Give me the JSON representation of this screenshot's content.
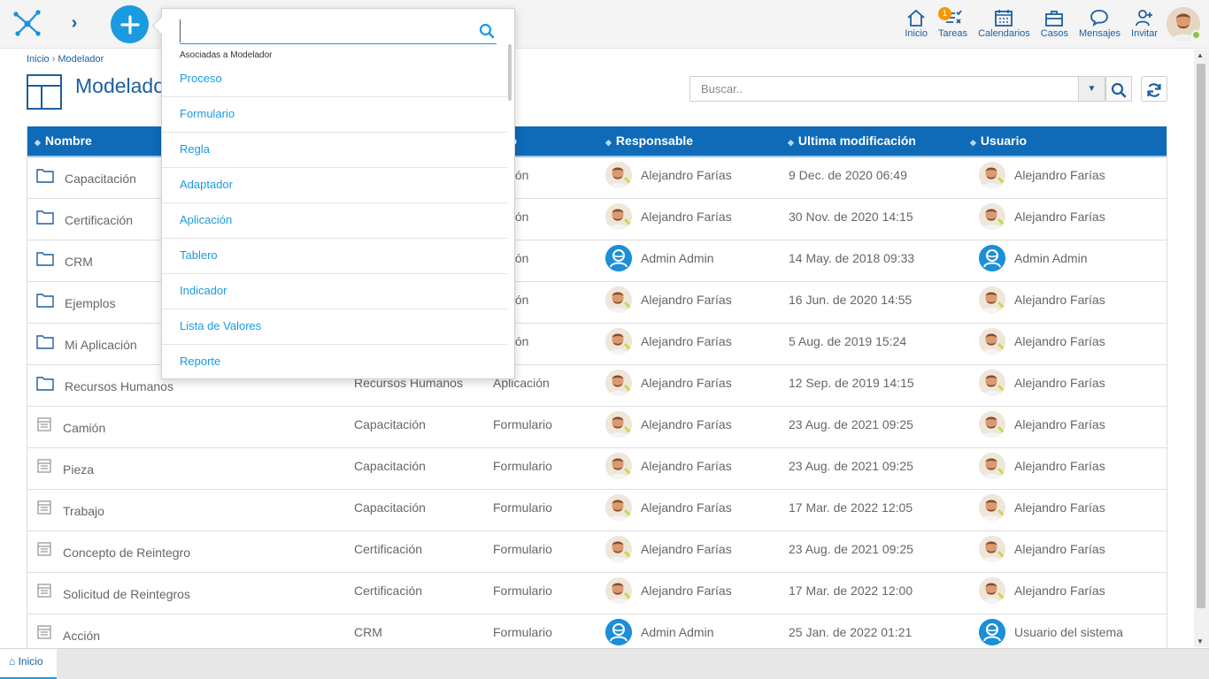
{
  "topbar": {
    "nav": [
      {
        "name": "home",
        "label": "Inicio",
        "icon": "home-icon"
      },
      {
        "name": "tasks",
        "label": "Tareas",
        "icon": "tasks-icon",
        "badge": "1"
      },
      {
        "name": "calendars",
        "label": "Calendarios",
        "icon": "calendar-icon"
      },
      {
        "name": "cases",
        "label": "Casos",
        "icon": "briefcase-icon"
      },
      {
        "name": "messages",
        "label": "Mensajes",
        "icon": "chat-icon"
      },
      {
        "name": "invite",
        "label": "Invitar",
        "icon": "add-user-icon"
      }
    ],
    "accent_color": "#1a9ae0",
    "brand_color": "#1b5f9e"
  },
  "breadcrumb": {
    "home": "Inicio",
    "sep": "›",
    "current": "Modelador"
  },
  "page": {
    "title": "Modelador"
  },
  "search": {
    "placeholder": "Buscar.."
  },
  "dropdown": {
    "header": "Asociadas a Modelador",
    "items": [
      "Proceso",
      "Formulario",
      "Regla",
      "Adaptador",
      "Aplicación",
      "Tablero",
      "Indicador",
      "Lista de Valores",
      "Reporte"
    ]
  },
  "table": {
    "headers": {
      "name": "Nombre",
      "type_partial": "po",
      "responsible": "Responsable",
      "modified": "Ultima modificación",
      "user": "Usuario"
    },
    "header_color": "#0f6ab7",
    "rows": [
      {
        "kind": "folder",
        "name": "Capacitación",
        "app": "",
        "type": "cación",
        "resp": "Alejandro Farías",
        "resp_avatar": "person",
        "date": "9 Dec. de 2020 06:49",
        "user": "Alejandro Farías",
        "user_avatar": "person"
      },
      {
        "kind": "folder",
        "name": "Certificación",
        "app": "",
        "type": "cación",
        "resp": "Alejandro Farías",
        "resp_avatar": "person",
        "date": "30 Nov. de 2020 14:15",
        "user": "Alejandro Farías",
        "user_avatar": "person"
      },
      {
        "kind": "folder",
        "name": "CRM",
        "app": "",
        "type": "cación",
        "resp": "Admin Admin",
        "resp_avatar": "admin",
        "date": "14 May. de 2018 09:33",
        "user": "Admin Admin",
        "user_avatar": "admin"
      },
      {
        "kind": "folder",
        "name": "Ejemplos",
        "app": "",
        "type": "cación",
        "resp": "Alejandro Farías",
        "resp_avatar": "person",
        "date": "16 Jun. de 2020 14:55",
        "user": "Alejandro Farías",
        "user_avatar": "person"
      },
      {
        "kind": "folder",
        "name": "Mi Aplicación",
        "app": "",
        "type": "cación",
        "resp": "Alejandro Farías",
        "resp_avatar": "person",
        "date": "5 Aug. de 2019 15:24",
        "user": "Alejandro Farías",
        "user_avatar": "person"
      },
      {
        "kind": "folder",
        "name": "Recursos Humanos",
        "app": "Recursos Humanos",
        "type": "Aplicación",
        "resp": "Alejandro Farías",
        "resp_avatar": "person",
        "date": "12 Sep. de 2019 14:15",
        "user": "Alejandro Farías",
        "user_avatar": "person"
      },
      {
        "kind": "form",
        "name": "Camión",
        "app": "Capacitación",
        "type": "Formulario",
        "resp": "Alejandro Farías",
        "resp_avatar": "person",
        "date": "23 Aug. de 2021 09:25",
        "user": "Alejandro Farías",
        "user_avatar": "person"
      },
      {
        "kind": "form",
        "name": "Pieza",
        "app": "Capacitación",
        "type": "Formulario",
        "resp": "Alejandro Farías",
        "resp_avatar": "person",
        "date": "23 Aug. de 2021 09:25",
        "user": "Alejandro Farías",
        "user_avatar": "person"
      },
      {
        "kind": "form",
        "name": "Trabajo",
        "app": "Capacitación",
        "type": "Formulario",
        "resp": "Alejandro Farías",
        "resp_avatar": "person",
        "date": "17 Mar. de 2022 12:05",
        "user": "Alejandro Farías",
        "user_avatar": "person"
      },
      {
        "kind": "form",
        "name": "Concepto de Reintegro",
        "app": "Certificación",
        "type": "Formulario",
        "resp": "Alejandro Farías",
        "resp_avatar": "person",
        "date": "23 Aug. de 2021 09:25",
        "user": "Alejandro Farías",
        "user_avatar": "person"
      },
      {
        "kind": "form",
        "name": "Solicitud de Reintegros",
        "app": "Certificación",
        "type": "Formulario",
        "resp": "Alejandro Farías",
        "resp_avatar": "person",
        "date": "17 Mar. de 2022 12:00",
        "user": "Alejandro Farías",
        "user_avatar": "person"
      },
      {
        "kind": "form",
        "name": "Acción",
        "app": "CRM",
        "type": "Formulario",
        "resp": "Admin Admin",
        "resp_avatar": "admin",
        "date": "25 Jan. de 2022 01:21",
        "user": "Usuario del sistema",
        "user_avatar": "admin"
      }
    ]
  },
  "bottom": {
    "tab_label": "Inicio"
  }
}
